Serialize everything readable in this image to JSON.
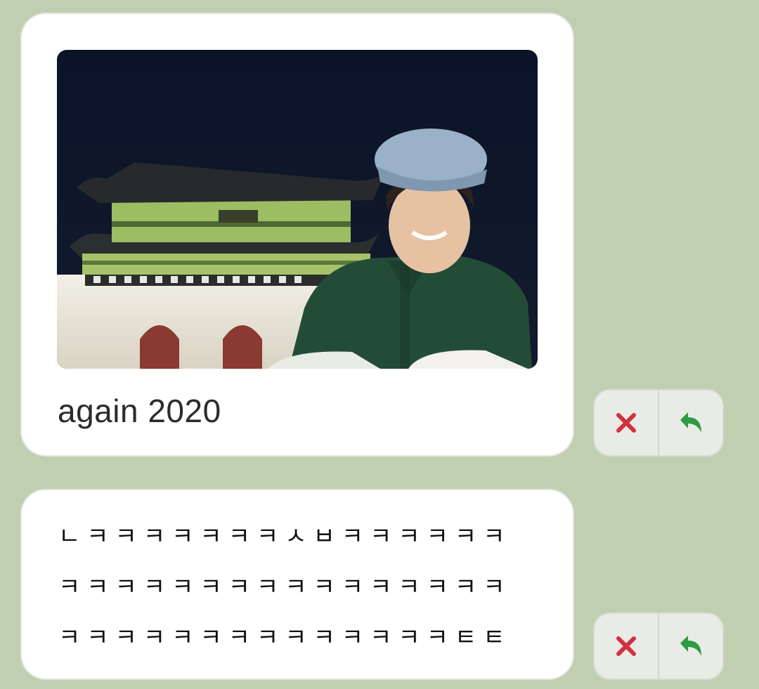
{
  "messages": [
    {
      "caption": "again 2020",
      "image": {
        "description_icon": "photo-icon"
      },
      "actions": {
        "delete_icon": "close-icon",
        "reply_icon": "reply-arrow-icon"
      }
    },
    {
      "text": "ㄴㅋㅋㅋㅋㅋㅋㅋㅅㅂㅋㅋㅋㅋㅋㅋ\nㅋㅋㅋㅋㅋㅋㅋㅋㅋㅋㅋㅋㅋㅋㅋㅋ\nㅋㅋㅋㅋㅋㅋㅋㅋㅋㅋㅋㅋㅋㅋㅌㅌ",
      "actions": {
        "delete_icon": "close-icon",
        "reply_icon": "reply-arrow-icon"
      }
    }
  ],
  "colors": {
    "background": "#c0cfb1",
    "bubble": "#ffffff",
    "delete": "#d2303f",
    "reply": "#2e9a44"
  }
}
